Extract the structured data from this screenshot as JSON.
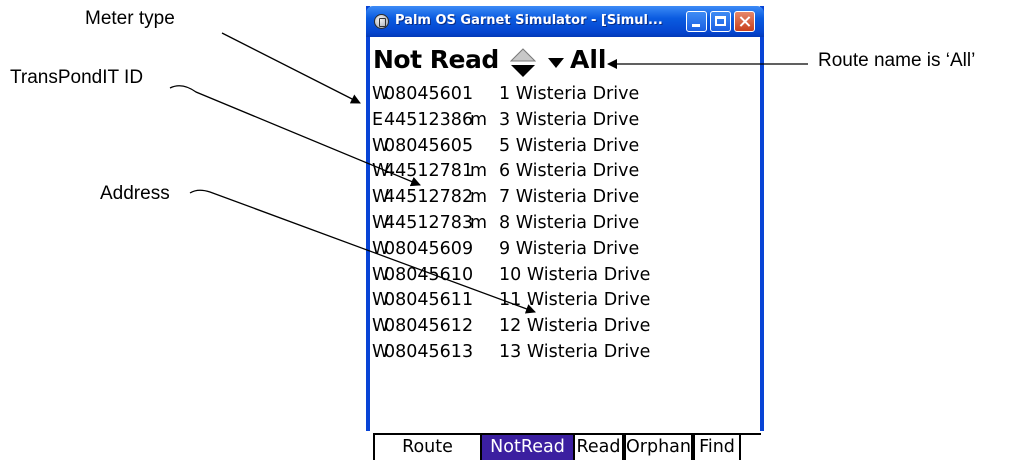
{
  "annotations": {
    "meter_type": "Meter type",
    "transpondit_id": "TransPondIT ID",
    "address": "Address",
    "route_name": "Route name is ‘All’"
  },
  "window": {
    "title": "Palm OS Garnet Simulator - [Simul...",
    "icon": "palm-app-icon",
    "controls": [
      "minimize",
      "maximize",
      "close"
    ]
  },
  "header": {
    "filter_label": "Not Read",
    "sort_icon": "up-down-sort-icon",
    "dropdown_icon": "dropdown-triangle-icon",
    "route_name": "All"
  },
  "meters": [
    {
      "type": "W",
      "id": "08045601",
      "flag": "",
      "address": "1 Wisteria Drive"
    },
    {
      "type": "E",
      "id": "44512386",
      "flag": "m",
      "address": "3 Wisteria Drive"
    },
    {
      "type": "W",
      "id": "08045605",
      "flag": "",
      "address": "5 Wisteria Drive"
    },
    {
      "type": "W",
      "id": "44512781",
      "flag": "m",
      "address": "6 Wisteria Drive"
    },
    {
      "type": "W",
      "id": "44512782",
      "flag": "m",
      "address": "7 Wisteria Drive"
    },
    {
      "type": "W",
      "id": "44512783",
      "flag": "m",
      "address": "8 Wisteria Drive"
    },
    {
      "type": "W",
      "id": "08045609",
      "flag": "",
      "address": "9 Wisteria Drive"
    },
    {
      "type": "W",
      "id": "08045610",
      "flag": "",
      "address": "10 Wisteria Drive"
    },
    {
      "type": "W",
      "id": "08045611",
      "flag": "",
      "address": "11 Wisteria Drive"
    },
    {
      "type": "W",
      "id": "08045612",
      "flag": "",
      "address": "12 Wisteria Drive"
    },
    {
      "type": "W",
      "id": "08045613",
      "flag": "",
      "address": "13 Wisteria Drive"
    }
  ],
  "tabs": [
    {
      "label": "Route",
      "active": false
    },
    {
      "label": "NotRead",
      "active": true
    },
    {
      "label": "Read",
      "active": false
    },
    {
      "label": "Orphan",
      "active": false
    },
    {
      "label": "Find",
      "active": false
    }
  ],
  "colors": {
    "titlebar": "#0a5be0",
    "window_border": "#0844d6",
    "active_tab": "#3b1fa0"
  }
}
